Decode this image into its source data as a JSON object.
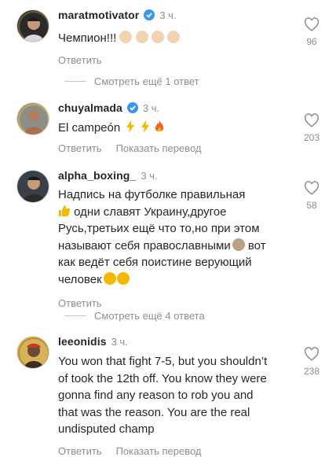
{
  "comments": [
    {
      "username": "maratmotivator",
      "verified": true,
      "time": "3 ч.",
      "text": "Чемпион!!!",
      "emoji_names": [
        "clap-icon",
        "clap-icon",
        "clap-icon",
        "clap-icon"
      ],
      "reply_label": "Ответить",
      "likes": "96"
    },
    {
      "username": "chuyalmada",
      "verified": true,
      "time": "3 ч.",
      "text": "El campeón",
      "emoji_names": [
        "lightning-icon",
        "lightning-icon",
        "fire-icon"
      ],
      "reply_label": "Ответить",
      "translate_label": "Показать перевод",
      "likes": "203"
    },
    {
      "username": "alpha_boxing_",
      "verified": false,
      "time": "3 ч.",
      "text_line1": "Надпись на футболке правильная",
      "text_line2": " одни славят Украину,другое",
      "text_line3": "Русь,третьих ещё что то,но при этом",
      "text_line4": "называют себя православными",
      "text_line4b": " вот",
      "text_line5": "как ведёт себя поистине верующий",
      "text_line6": "человек",
      "emoji_names": [
        "thumbs-up-icon",
        "facepalm-icon",
        "clap-icon",
        "handshake-icon"
      ],
      "reply_label": "Ответить",
      "likes": "58"
    },
    {
      "username": "leeonidis",
      "verified": false,
      "time": "3 ч.",
      "text_line1": "You won that fight 7-5, but you shouldn’t",
      "text_line2": "of took the 12th off. You know they were",
      "text_line3": "gonna find any reason to rob you and",
      "text_line4": "that was the reason. You are the real",
      "text_line5": "undisputed champ",
      "reply_label": "Ответить",
      "translate_label": "Показать перевод",
      "likes": "238"
    }
  ],
  "view_more": [
    "Смотреть ещё 1 ответ",
    "Смотреть ещё 4 ответа"
  ],
  "colors": {
    "text": "#262626",
    "muted": "#8e8e8e",
    "verified": "#3897f0"
  }
}
